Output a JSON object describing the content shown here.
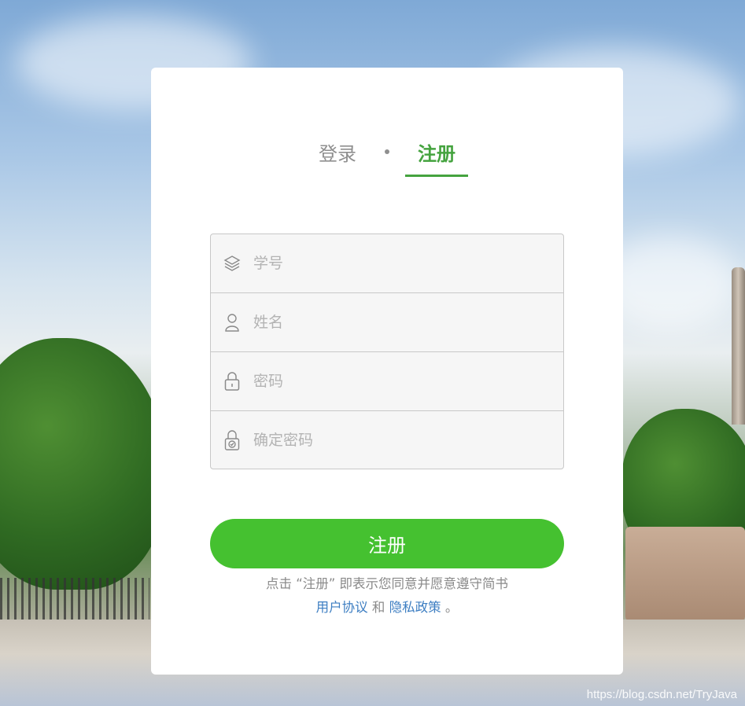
{
  "tabs": {
    "login": "登录",
    "register": "注册"
  },
  "form": {
    "student_id_placeholder": "学号",
    "name_placeholder": "姓名",
    "password_placeholder": "密码",
    "confirm_password_placeholder": "确定密码"
  },
  "submit_label": "注册",
  "agreement": {
    "text_before": "点击 “注册” 即表示您同意并愿意遵守简书",
    "user_agreement": "用户协议",
    "and": "和",
    "privacy_policy": "隐私政策",
    "end": "。"
  },
  "watermark": "https://blog.csdn.net/TryJava",
  "colors": {
    "accent": "#45a33f",
    "button": "#45c130",
    "link": "#3d7ec2"
  },
  "icons": [
    "layers-icon",
    "user-icon",
    "lock-icon",
    "lock-check-icon"
  ]
}
